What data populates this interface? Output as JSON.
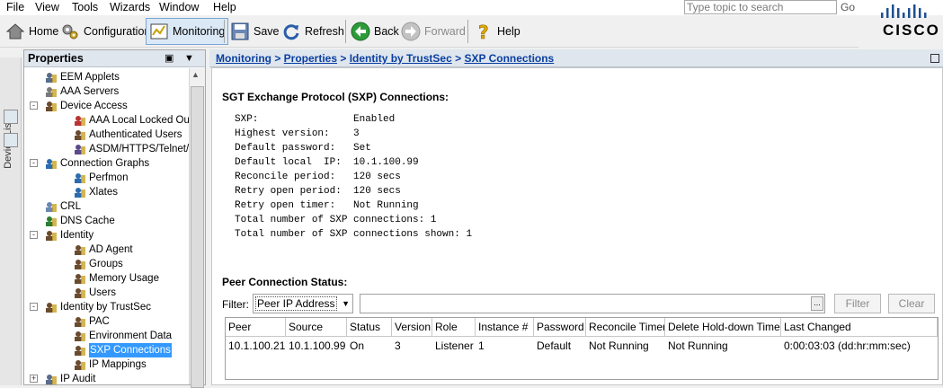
{
  "menu": [
    "File",
    "View",
    "Tools",
    "Wizards",
    "Window",
    "Help"
  ],
  "search": {
    "placeholder": "Type topic to search",
    "go_label": "Go"
  },
  "brand": {
    "logo_text": "CISCO"
  },
  "toolbar": {
    "home": "Home",
    "configuration": "Configuration",
    "monitoring": "Monitoring",
    "save": "Save",
    "refresh": "Refresh",
    "back": "Back",
    "forward": "Forward",
    "help": "Help"
  },
  "vtab": {
    "label": "Device List"
  },
  "properties": {
    "title": "Properties",
    "tree": [
      {
        "label": "EEM Applets",
        "icon": "applet-icon"
      },
      {
        "label": "AAA Servers",
        "icon": "server-icon"
      },
      {
        "label": "Device Access",
        "icon": "users-icon"
      },
      {
        "label": "AAA Local Locked Out Use",
        "icon": "locked-user-icon"
      },
      {
        "label": "Authenticated Users",
        "icon": "users-icon"
      },
      {
        "label": "ASDM/HTTPS/Telnet/SSH",
        "icon": "session-icon"
      },
      {
        "label": "Connection Graphs",
        "icon": "graph-icon"
      },
      {
        "label": "Perfmon",
        "icon": "calendar-icon"
      },
      {
        "label": "Xlates",
        "icon": "grid-icon"
      },
      {
        "label": "CRL",
        "icon": "document-icon"
      },
      {
        "label": "DNS Cache",
        "icon": "globe-icon"
      },
      {
        "label": "Identity",
        "icon": "users-icon"
      },
      {
        "label": "AD Agent",
        "icon": "users-icon"
      },
      {
        "label": "Groups",
        "icon": "users-icon"
      },
      {
        "label": "Memory Usage",
        "icon": "users-icon"
      },
      {
        "label": "Users",
        "icon": "users-icon"
      },
      {
        "label": "Identity by TrustSec",
        "icon": "users-icon"
      },
      {
        "label": "PAC",
        "icon": "users-icon"
      },
      {
        "label": "Environment Data",
        "icon": "users-icon"
      },
      {
        "label": "SXP Connections",
        "icon": "users-icon"
      },
      {
        "label": "IP Mappings",
        "icon": "users-icon"
      },
      {
        "label": "IP Audit",
        "icon": "audit-icon"
      }
    ]
  },
  "breadcrumb": {
    "parts": [
      "Monitoring",
      "Properties",
      "Identity by TrustSec",
      "SXP Connections"
    ],
    "separator": " > "
  },
  "sxp": {
    "title": "SGT Exchange Protocol (SXP) Connections:",
    "rows": [
      {
        "key": "SXP:",
        "value": "Enabled"
      },
      {
        "key": "Highest version:",
        "value": "3"
      },
      {
        "key": "Default password:",
        "value": "Set"
      },
      {
        "key": "Default local  IP:",
        "value": "10.1.100.99"
      },
      {
        "key": "Reconcile period:",
        "value": "120 secs"
      },
      {
        "key": "Retry open period:",
        "value": "120 secs"
      },
      {
        "key": "Retry open timer:",
        "value": "Not Running"
      },
      {
        "key": "Total number of SXP connections:",
        "value": "1"
      },
      {
        "key": "Total number of SXP connections shown:",
        "value": "1"
      }
    ]
  },
  "peer": {
    "title": "Peer Connection Status:",
    "filter_label": "Filter:",
    "filter_selected": "Peer IP Address",
    "filter_value": "",
    "filter_button": "Filter",
    "clear_button": "Clear",
    "ellipsis": "...",
    "columns": [
      "Peer",
      "Source",
      "Status",
      "Version",
      "Role",
      "Instance #",
      "Password",
      "Reconcile Timer",
      "Delete Hold-down Timer",
      "Last Changed"
    ],
    "rows": [
      [
        "10.1.100.21",
        "10.1.100.99",
        "On",
        "3",
        "Listener",
        "1",
        "Default",
        "Not Running",
        "Not Running",
        "0:00:03:03 (dd:hr:mm:sec)"
      ]
    ]
  },
  "colors": {
    "accent": "#0a3fa0",
    "selection": "#3399ff",
    "header_bg": "#dfe6ee"
  }
}
